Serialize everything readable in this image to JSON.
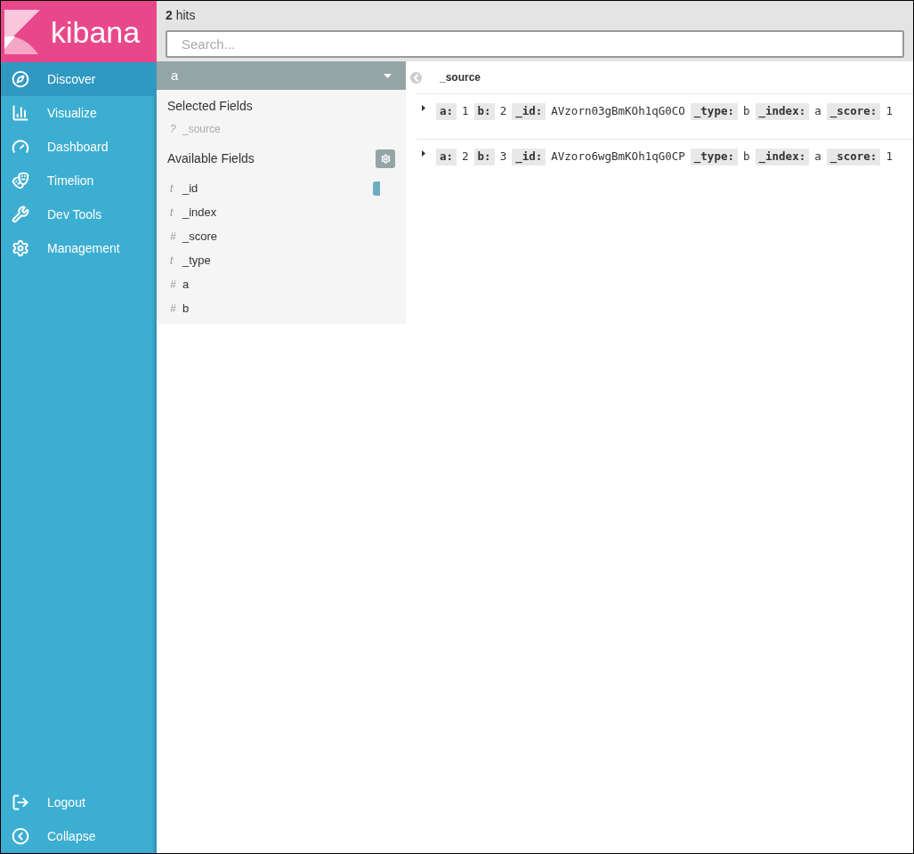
{
  "logo": {
    "text": "kibana"
  },
  "nav": [
    {
      "label": "Discover",
      "selected": true
    },
    {
      "label": "Visualize",
      "selected": false
    },
    {
      "label": "Dashboard",
      "selected": false
    },
    {
      "label": "Timelion",
      "selected": false
    },
    {
      "label": "Dev Tools",
      "selected": false
    },
    {
      "label": "Management",
      "selected": false
    }
  ],
  "nav_bottom": [
    {
      "label": "Logout"
    },
    {
      "label": "Collapse"
    }
  ],
  "hits": "**2** hits",
  "search": {
    "placeholder": "Search..."
  },
  "index_pattern": "a",
  "selected_fields": {
    "title": "Selected Fields",
    "items": [
      {
        "type_glyph": "?",
        "name": "_source"
      }
    ]
  },
  "available_fields": {
    "title": "Available Fields",
    "items": [
      {
        "type_glyph": "t",
        "name": "_id",
        "add_button": true
      },
      {
        "type_glyph": "t",
        "name": "_index",
        "add_button": false
      },
      {
        "type_glyph": "#",
        "name": "_score",
        "add_button": false
      },
      {
        "type_glyph": "t",
        "name": "_type",
        "add_button": false
      },
      {
        "type_glyph": "#",
        "name": "a",
        "add_button": false
      },
      {
        "type_glyph": "#",
        "name": "b",
        "add_button": false
      }
    ]
  },
  "table": {
    "column": "_source",
    "rows": [
      {
        "pairs": [
          {
            "key": "a:",
            "value": "1"
          },
          {
            "key": "b:",
            "value": "2"
          },
          {
            "key": "_id:",
            "value": "AVzorn03gBmKOh1qG0CO"
          },
          {
            "key": "_type:",
            "value": "b"
          },
          {
            "key": "_index:",
            "value": "a"
          },
          {
            "key": "_score:",
            "value": "1"
          }
        ]
      },
      {
        "pairs": [
          {
            "key": "a:",
            "value": "2"
          },
          {
            "key": "b:",
            "value": "3"
          },
          {
            "key": "_id:",
            "value": "AVzoro6wgBmKOh1qG0CP"
          },
          {
            "key": "_type:",
            "value": "b"
          },
          {
            "key": "_index:",
            "value": "a"
          },
          {
            "key": "_score:",
            "value": "1"
          }
        ]
      }
    ]
  }
}
